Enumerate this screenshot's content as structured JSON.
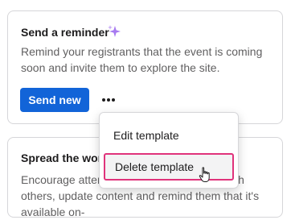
{
  "reminder_card": {
    "title": "Send a reminder",
    "sparkle_icon": "sparkle-icon",
    "description": "Remind your registrants that the event is coming soon and invite them to explore the site.",
    "send_button": "Send new",
    "more_icon": "more-horizontal-icon"
  },
  "spread_card": {
    "title": "Spread the word",
    "description": "Encourage attendees to share the event with others, update content and remind them that it's available on-"
  },
  "menu": {
    "items": [
      {
        "label": "Edit template"
      },
      {
        "label": "Delete template"
      }
    ]
  },
  "colors": {
    "primary": "#1264d8",
    "highlight_border": "#e0337b",
    "sparkle": "#a77af0"
  }
}
